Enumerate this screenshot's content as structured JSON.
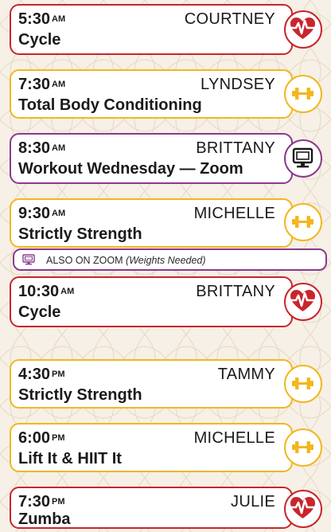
{
  "colors": {
    "red": "#c9252c",
    "yellow": "#f2b71f",
    "purple": "#8a3a8f"
  },
  "classes": [
    {
      "time": "5:30",
      "ampm": "AM",
      "instructor": "COURTNEY",
      "name": "Cycle",
      "color": "red",
      "icon": "heart-pulse-icon"
    },
    {
      "time": "7:30",
      "ampm": "AM",
      "instructor": "LYNDSEY",
      "name": "Total Body Conditioning",
      "color": "yellow",
      "icon": "dumbbell-icon"
    },
    {
      "time": "8:30",
      "ampm": "AM",
      "instructor": "BRITTANY",
      "name": "Workout Wednesday — Zoom",
      "color": "purple",
      "icon": "monitor-icon"
    },
    {
      "time": "9:30",
      "ampm": "AM",
      "instructor": "MICHELLE",
      "name": "Strictly Strength",
      "color": "yellow",
      "icon": "dumbbell-icon"
    },
    {
      "time": "10:30",
      "ampm": "AM",
      "instructor": "BRITTANY",
      "name": "Cycle",
      "color": "red",
      "icon": "heart-pulse-icon"
    },
    {
      "time": "4:30",
      "ampm": "PM",
      "instructor": "TAMMY",
      "name": "Strictly Strength",
      "color": "yellow",
      "icon": "dumbbell-icon"
    },
    {
      "time": "6:00",
      "ampm": "PM",
      "instructor": "MICHELLE",
      "name": "Lift It & HIIT It",
      "color": "yellow",
      "icon": "dumbbell-icon"
    },
    {
      "time": "7:30",
      "ampm": "PM",
      "instructor": "JULIE",
      "name": "Zumba",
      "color": "red",
      "icon": "heart-pulse-icon"
    }
  ],
  "zoom_note": {
    "text": "ALSO ON ZOOM",
    "subtext": "(Weights Needed)",
    "icon": "monitor-icon"
  }
}
